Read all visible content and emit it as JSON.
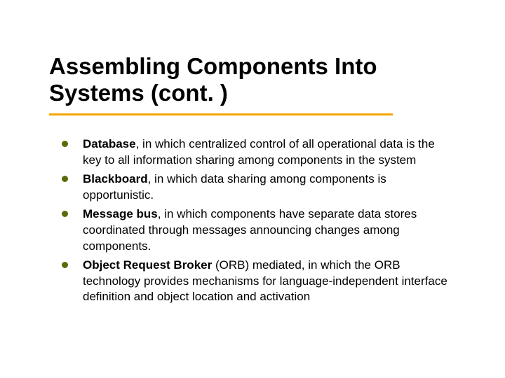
{
  "title": "Assembling Components Into Systems (cont. )",
  "bullets": [
    {
      "strong": "Database",
      "rest": ", in which centralized control of all operational data is the key to all information sharing among components in the system"
    },
    {
      "strong": "Blackboard",
      "rest": ", in which data sharing among components is opportunistic."
    },
    {
      "strong": "Message bus",
      "rest": ", in which components have separate data stores coordinated through messages announcing changes among components."
    },
    {
      "strong": "Object Request Broker",
      "rest": " (ORB) mediated, in which the ORB technology provides mechanisms for language-independent interface definition and object location and activation"
    }
  ],
  "colors": {
    "underline": "#f7a500",
    "bullet_dot": "#5a6b08"
  }
}
